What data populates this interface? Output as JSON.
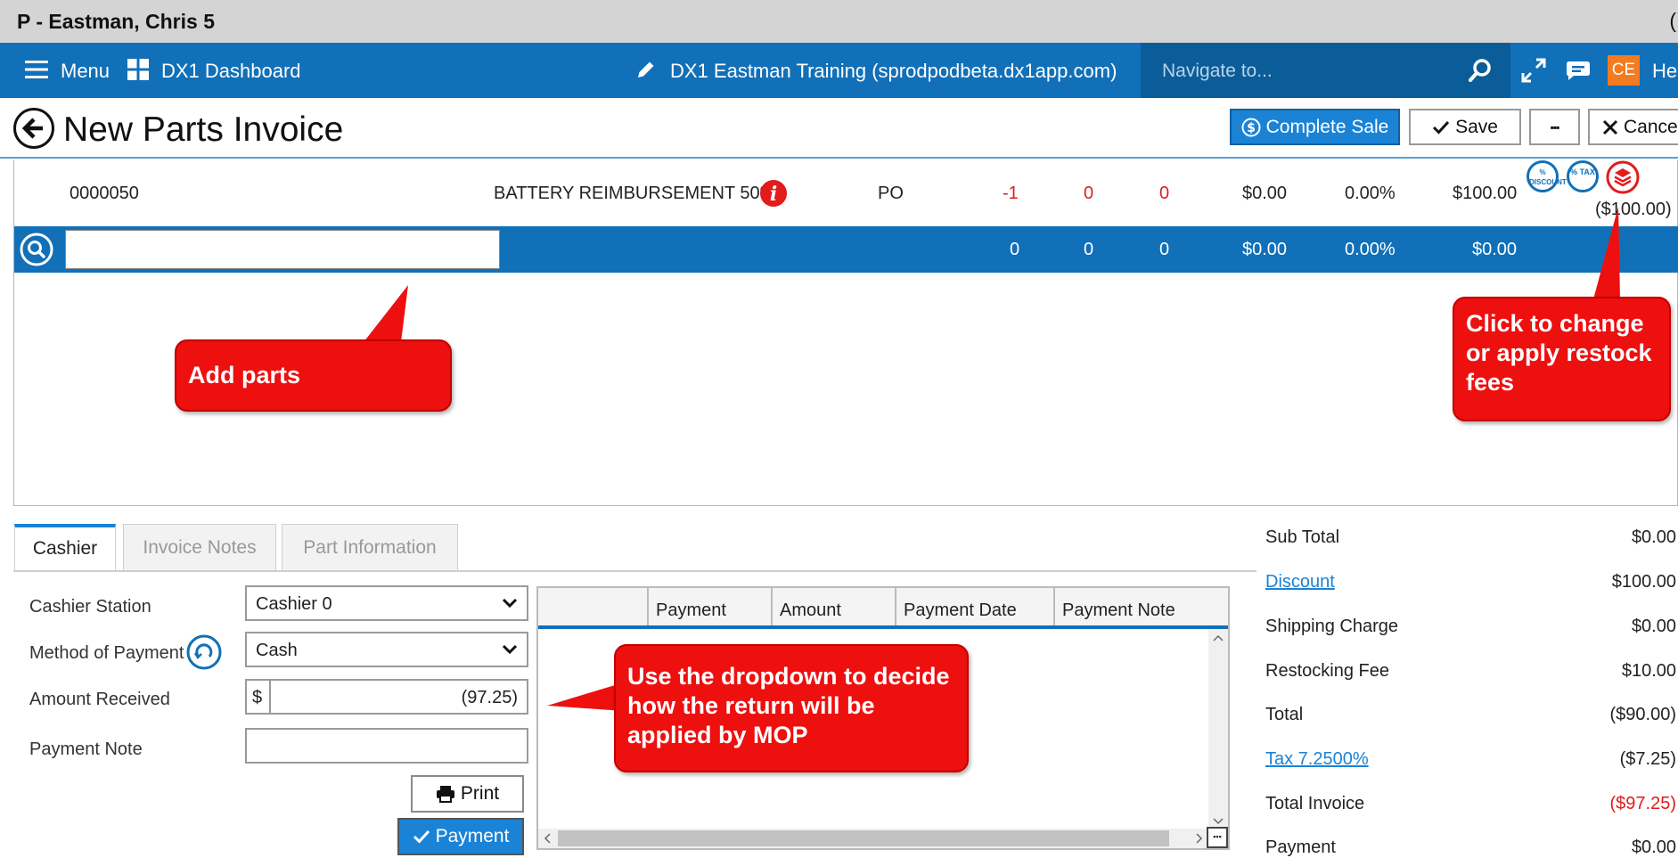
{
  "window": {
    "title": "P - Eastman, Chris 5",
    "edge_glyph": "("
  },
  "nav": {
    "menu_label": "Menu",
    "dashboard_label": "DX1 Dashboard",
    "environment": "DX1 Eastman Training (sprodpodbeta.dx1app.com)",
    "search_placeholder": "Navigate to...",
    "user_initials": "CE",
    "help_label": "He"
  },
  "header": {
    "title": "New Parts Invoice",
    "complete_sale": "Complete Sale",
    "save": "Save",
    "more": "▪▪▪",
    "cancel": "Cance"
  },
  "line_item": {
    "part_number": "0000050",
    "description": "BATTERY REIMBURSEMENT 50%",
    "type": "PO",
    "qty1": "-1",
    "qty2": "0",
    "qty3": "0",
    "price": "$0.00",
    "pct": "0.00%",
    "amount": "$100.00",
    "restock": "($100.00)",
    "discount_icon_label": "% DISCOUNT",
    "tax_icon_label": "% TAX"
  },
  "entry_row": {
    "qty1": "0",
    "qty2": "0",
    "qty3": "0",
    "price": "$0.00",
    "pct": "0.00%",
    "amount": "$0.00"
  },
  "callouts": {
    "add_parts": "Add parts",
    "restock": "Click to change or apply restock fees",
    "dropdown": "Use the dropdown to decide how the return will be applied by MOP"
  },
  "tabs": [
    "Cashier",
    "Invoice Notes",
    "Part Information"
  ],
  "cashier": {
    "station_label": "Cashier Station",
    "station_value": "Cashier 0",
    "mop_label": "Method of Payment",
    "mop_value": "Cash",
    "amount_label": "Amount Received",
    "amount_prefix": "$",
    "amount_value": "(97.25)",
    "note_label": "Payment Note",
    "note_value": "",
    "print": "Print",
    "payment": "Payment"
  },
  "payment_grid": {
    "columns": [
      "",
      "Payment",
      "Amount",
      "Payment Date",
      "Payment Note"
    ],
    "rows": []
  },
  "totals": [
    {
      "label": "Sub Total",
      "value": "$0.00",
      "link": false,
      "red": false
    },
    {
      "label": "Discount",
      "value": "$100.00",
      "link": true,
      "red": false
    },
    {
      "label": "Shipping Charge",
      "value": "$0.00",
      "link": false,
      "red": false
    },
    {
      "label": "Restocking Fee",
      "value": "$10.00",
      "link": false,
      "red": false
    },
    {
      "label": "Total",
      "value": "($90.00)",
      "link": false,
      "red": false
    },
    {
      "label": "Tax 7.2500%",
      "value": "($7.25)",
      "link": true,
      "red": false
    },
    {
      "label": "Total Invoice",
      "value": "($97.25)",
      "link": false,
      "red": true
    },
    {
      "label": "Payment",
      "value": "$0.00",
      "link": false,
      "red": false
    }
  ],
  "colors": {
    "nav_blue": "#1170b8",
    "accent_blue": "#1a83d6",
    "callout_red": "#ee0f0f",
    "avatar_orange": "#f47b20"
  }
}
